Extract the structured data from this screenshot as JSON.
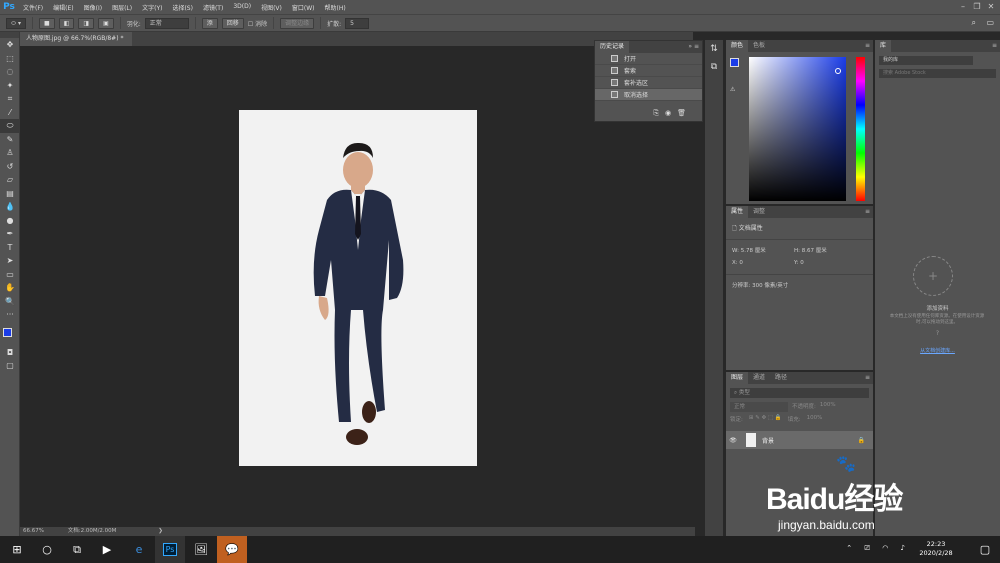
{
  "app": {
    "logo": "Ps"
  },
  "menu": [
    "文件(F)",
    "编辑(E)",
    "图像(I)",
    "图层(L)",
    "文字(Y)",
    "选择(S)",
    "滤镜(T)",
    "3D(D)",
    "视图(V)",
    "窗口(W)",
    "帮助(H)"
  ],
  "options": {
    "feather_label": "羽化:",
    "feather_value": "正常",
    "btn_a": "添",
    "btn_b": "回移",
    "antialias_label": "消除",
    "select_mask": "调整边缘",
    "expand_label": "扩散:",
    "expand_value": "5"
  },
  "document": {
    "tab_title": "人物原图.jpg @ 66.7%(RGB/8#) *",
    "zoom": "66.67%",
    "doc_info": "文档:2.00M/2.00M"
  },
  "history": {
    "tabs": [
      "历史记录"
    ],
    "items": [
      "打开",
      "套索",
      "套补选区",
      "取消选择"
    ]
  },
  "color": {
    "tabs": [
      "颜色",
      "色板"
    ],
    "fg": "#1a3ce8",
    "bg": "#ffffff"
  },
  "properties": {
    "tabs": [
      "属性",
      "调整"
    ],
    "title": "文档属性",
    "w": "W: 5.78 厘米",
    "h": "H: 8.67 厘米",
    "x": "X: 0",
    "y": "Y: 0",
    "resolution": "分辨率: 300 像素/英寸"
  },
  "layers": {
    "tabs": [
      "图层",
      "通道",
      "路径"
    ],
    "search_placeholder": "类型",
    "blend": "正常",
    "opacity_label": "不透明度:",
    "opacity": "100%",
    "lock_label": "锁定:",
    "fill_label": "填充:",
    "fill": "100%",
    "layer_name": "背景"
  },
  "library": {
    "tabs": [
      "库"
    ],
    "dropdown": "我的库",
    "search": "搜索 Adobe Stock",
    "title": "添加资料",
    "desc": "本文档上没有使用任何库资源。在使用设计资源时,可以拖动到这里。",
    "link": "从文档创建库..."
  },
  "taskbar": {
    "time": "22:23",
    "date": "2020/2/28"
  },
  "watermark": {
    "brand": "Baidu经验",
    "url": "jingyan.baidu.com"
  }
}
